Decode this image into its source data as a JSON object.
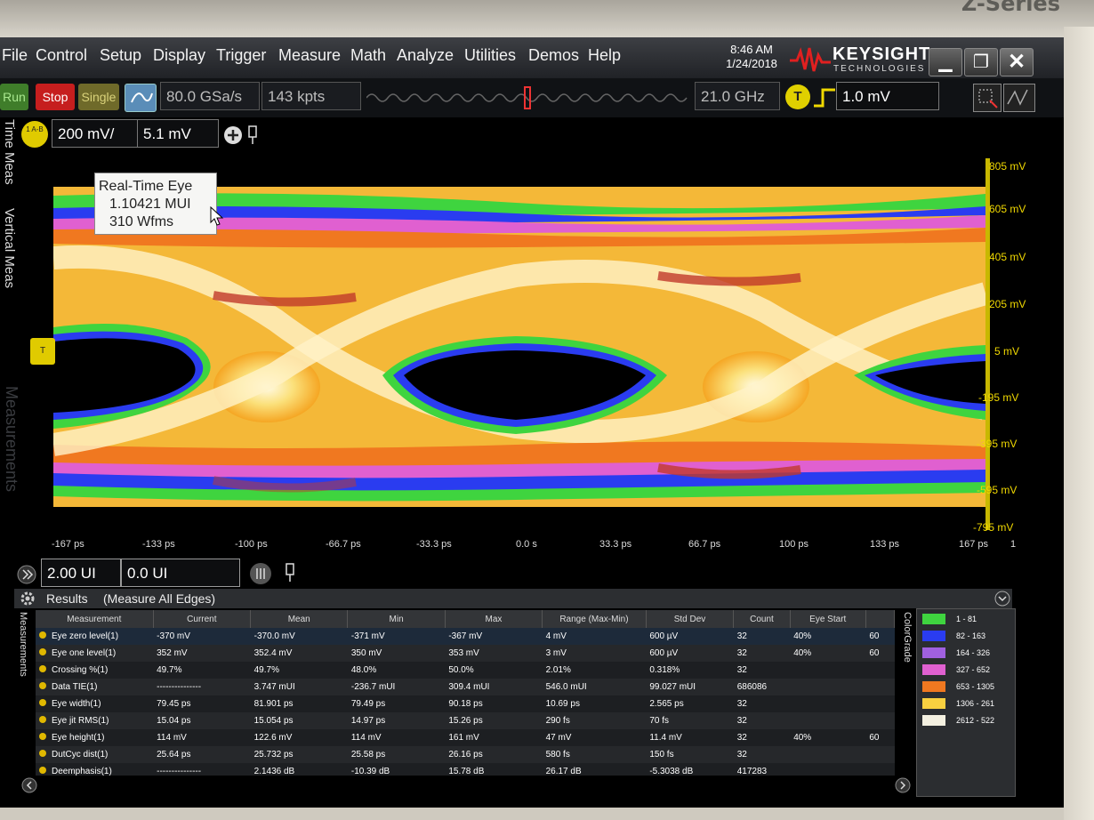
{
  "bezel": {
    "series": "Z-Series"
  },
  "menu": [
    "File",
    "Control",
    "Setup",
    "Display",
    "Trigger",
    "Measure",
    "Math",
    "Analyze",
    "Utilities",
    "Demos",
    "Help"
  ],
  "clock": {
    "time": "8:46 AM",
    "date": "1/24/2018"
  },
  "brand": {
    "name": "KEYSIGHT",
    "sub": "TECHNOLOGIES"
  },
  "toolbar": {
    "run": "Run",
    "stop": "Stop",
    "single": "Single",
    "sample_rate": "80.0 GSa/s",
    "memory": "143 kpts",
    "bandwidth": "21.0 GHz",
    "trigger_icon": "T",
    "trigger_level": "1.0 mV"
  },
  "channel": {
    "badge": "1 A-B",
    "scale": "200 mV/",
    "offset": "5.1 mV"
  },
  "side_tabs": {
    "time": "Time Meas",
    "vertical": "Vertical Meas",
    "measurements": "Measurements"
  },
  "tooltip": {
    "line1": "Real-Time Eye",
    "line2": "1.10421 MUI",
    "line3": "310 Wfms"
  },
  "y_axis_labels": [
    "805 mV",
    "605 mV",
    "405 mV",
    "205 mV",
    "5 mV",
    "-195 mV",
    "-395 mV",
    "-595 mV",
    "-795 mV"
  ],
  "x_axis_labels": [
    "-167 ps",
    "-133 ps",
    "-100 ps",
    "-66.7 ps",
    "-33.3 ps",
    "0.0 s",
    "33.3 ps",
    "66.7 ps",
    "100 ps",
    "133 ps",
    "167 ps"
  ],
  "x_axis_extra": "1",
  "ui_controls": {
    "ui_scale": "2.00 UI",
    "ui_offset": "0.0 UI"
  },
  "results": {
    "title": "Results",
    "subtitle": "(Measure All Edges)"
  },
  "table": {
    "headers": [
      "Measurement",
      "Current",
      "Mean",
      "Min",
      "Max",
      "Range (Max-Min)",
      "Std Dev",
      "Count",
      "Eye Start",
      ""
    ],
    "rows": [
      [
        "Eye zero level(1)",
        "-370 mV",
        "-370.0 mV",
        "-371 mV",
        "-367 mV",
        "4 mV",
        "600 µV",
        "32",
        "40%",
        "60"
      ],
      [
        "Eye one level(1)",
        "352 mV",
        "352.4 mV",
        "350 mV",
        "353 mV",
        "3 mV",
        "600 µV",
        "32",
        "40%",
        "60"
      ],
      [
        "Crossing %(1)",
        "49.7%",
        "49.7%",
        "48.0%",
        "50.0%",
        "2.01%",
        "0.318%",
        "32",
        "",
        ""
      ],
      [
        "Data TIE(1)",
        "---------------",
        "3.747 mUI",
        "-236.7 mUI",
        "309.4 mUI",
        "546.0 mUI",
        "99.027 mUI",
        "686086",
        "",
        ""
      ],
      [
        "Eye width(1)",
        "79.45 ps",
        "81.901 ps",
        "79.49 ps",
        "90.18 ps",
        "10.69 ps",
        "2.565 ps",
        "32",
        "",
        ""
      ],
      [
        "Eye jit RMS(1)",
        "15.04 ps",
        "15.054 ps",
        "14.97 ps",
        "15.26 ps",
        "290 fs",
        "70 fs",
        "32",
        "",
        ""
      ],
      [
        "Eye height(1)",
        "114 mV",
        "122.6 mV",
        "114 mV",
        "161 mV",
        "47 mV",
        "11.4 mV",
        "32",
        "40%",
        "60"
      ],
      [
        "DutCyc dist(1)",
        "25.64 ps",
        "25.732 ps",
        "25.58 ps",
        "26.16 ps",
        "580 fs",
        "150 fs",
        "32",
        "",
        ""
      ],
      [
        "Deemphasis(1)",
        "---------------",
        "2.1436 dB",
        "-10.39 dB",
        "15.78 dB",
        "26.17 dB",
        "-5.3038 dB",
        "417283",
        "",
        ""
      ]
    ]
  },
  "colorgrade": {
    "title": "ColorGrade",
    "entries": [
      {
        "label": "1 - 81",
        "color": "#3fd43f"
      },
      {
        "label": "82 - 163",
        "color": "#2a3cf0"
      },
      {
        "label": "164 - 326",
        "color": "#a060e0"
      },
      {
        "label": "327 - 652",
        "color": "#e060d0"
      },
      {
        "label": "653 - 1305",
        "color": "#f07820"
      },
      {
        "label": "1306 - 261",
        "color": "#f8d040"
      },
      {
        "label": "2612 - 522",
        "color": "#f4f0e0"
      }
    ]
  }
}
